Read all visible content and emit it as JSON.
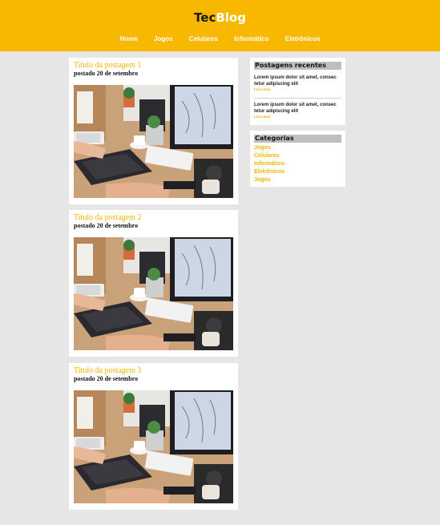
{
  "site": {
    "brand_part1": "Tec",
    "brand_part2": "Blog",
    "nav": [
      "Home",
      "Jogos",
      "Celulares",
      "Informático",
      "Eletrônicos"
    ]
  },
  "posts": [
    {
      "title": "Titulo da postagem 1",
      "date": "postado 20 de setembro"
    },
    {
      "title": "Titulo da postagem 2",
      "date": "postado 20 de setembro"
    },
    {
      "title": "Titulo da postagem 3",
      "date": "postado 20 de setembro"
    }
  ],
  "sidebar": {
    "recent": {
      "title": "Postagens recentes",
      "items": [
        {
          "text": "Lorem ipsum dolor sit amet, consec tetur adipiscing elit",
          "more": "Leia mais"
        },
        {
          "text": "Lorem ipsum dolor sit amet, consec tetur adipiscing elit",
          "more": "Leia mais"
        }
      ]
    },
    "categories": {
      "title": "Categorias",
      "items": [
        "Jogos",
        "Celulares",
        "Informático",
        "Eletrônicos",
        "Jogos"
      ]
    }
  },
  "colors": {
    "accent": "#f9b800",
    "link": "#f4b400",
    "background": "#e6e6e6"
  }
}
